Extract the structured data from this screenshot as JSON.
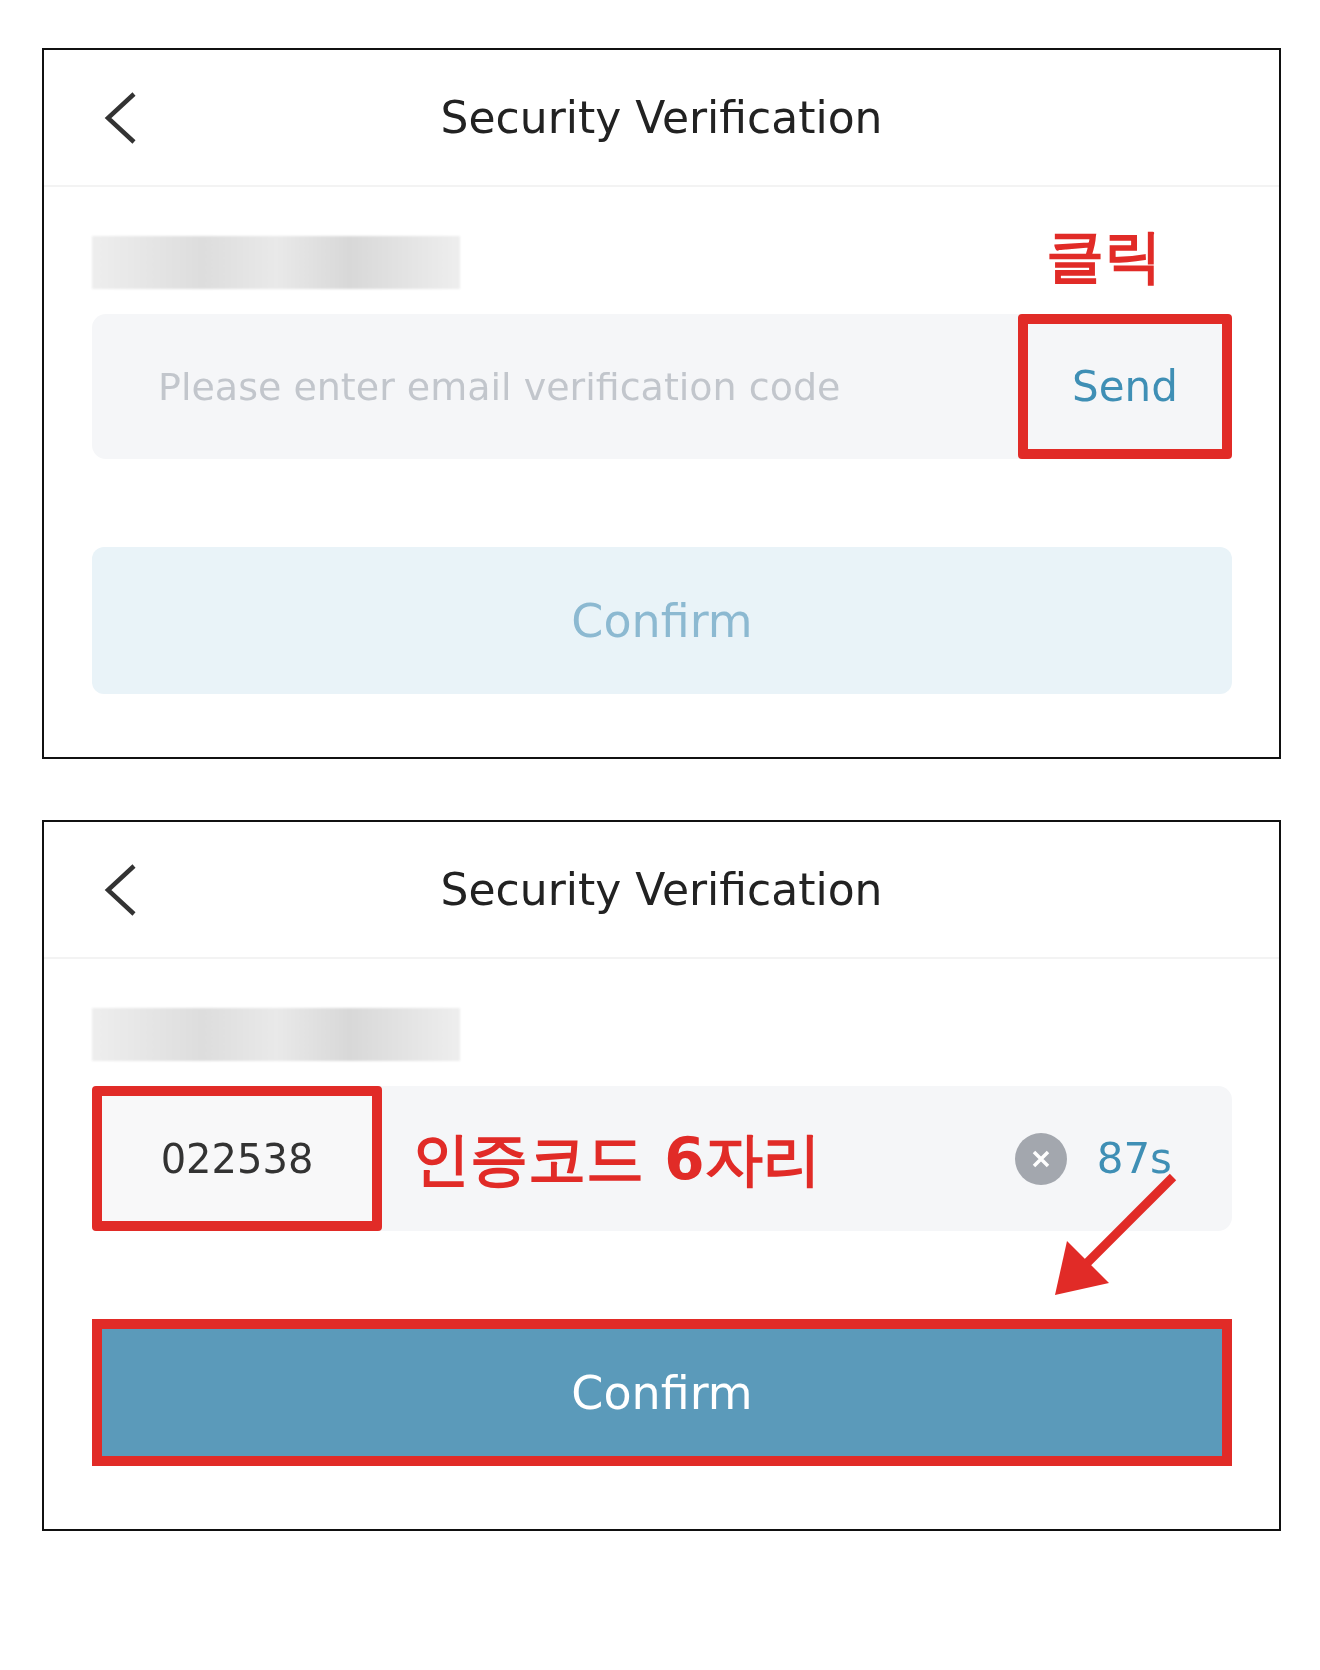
{
  "screens": [
    {
      "title": "Security Verification",
      "field": {
        "placeholder": "Please enter email verification code",
        "highlighted": false
      },
      "action": {
        "kind": "send",
        "label": "Send",
        "highlighted": true
      },
      "annotation": {
        "text": "클릭",
        "arrow": false
      },
      "confirm": {
        "label": "Confirm",
        "disabled": true,
        "highlighted": false
      }
    },
    {
      "title": "Security Verification",
      "field": {
        "value": "022538",
        "highlighted": true
      },
      "action": {
        "kind": "countdown",
        "label": "87s",
        "highlighted": false
      },
      "annotation": {
        "text": "인증코드 6자리",
        "arrow": true
      },
      "confirm": {
        "label": "Confirm",
        "disabled": false,
        "highlighted": true
      }
    }
  ]
}
